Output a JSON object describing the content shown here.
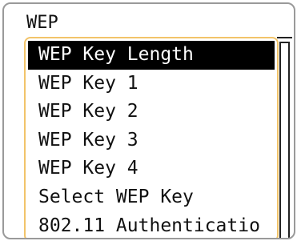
{
  "screen": {
    "title": "WEP"
  },
  "menu": {
    "items": [
      {
        "label": "WEP Key Length",
        "selected": true
      },
      {
        "label": "WEP Key 1",
        "selected": false
      },
      {
        "label": "WEP Key 2",
        "selected": false
      },
      {
        "label": "WEP Key 3",
        "selected": false
      },
      {
        "label": "WEP Key 4",
        "selected": false
      },
      {
        "label": "Select WEP Key",
        "selected": false
      },
      {
        "label": "802.11 Authenticatio",
        "selected": false
      }
    ]
  },
  "colors": {
    "focus_border": "#f2c46a",
    "selected_bg": "#000000",
    "selected_text": "#ffffff",
    "frame_border": "#9a9a9a"
  }
}
